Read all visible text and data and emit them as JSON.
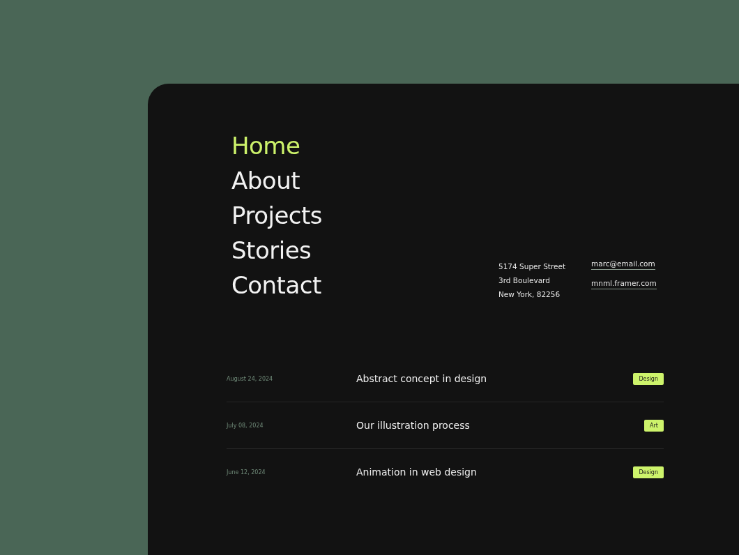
{
  "nav": [
    {
      "label": "Home",
      "selected": true
    },
    {
      "label": "About",
      "selected": false
    },
    {
      "label": "Projects",
      "selected": false
    },
    {
      "label": "Stories",
      "selected": false
    },
    {
      "label": "Contact",
      "selected": false
    }
  ],
  "address": [
    "5174 Super Street",
    "3rd Boulevard",
    "New York, 82256"
  ],
  "links": [
    "marc@email.com",
    "mnml.framer.com"
  ],
  "posts": [
    {
      "date": "August 24, 2024",
      "title": "Abstract concept in design",
      "tag": "Design"
    },
    {
      "date": "July 08, 2024",
      "title": "Our illustration process",
      "tag": "Art"
    },
    {
      "date": "June 12, 2024",
      "title": "Animation in web design",
      "tag": "Design"
    }
  ]
}
